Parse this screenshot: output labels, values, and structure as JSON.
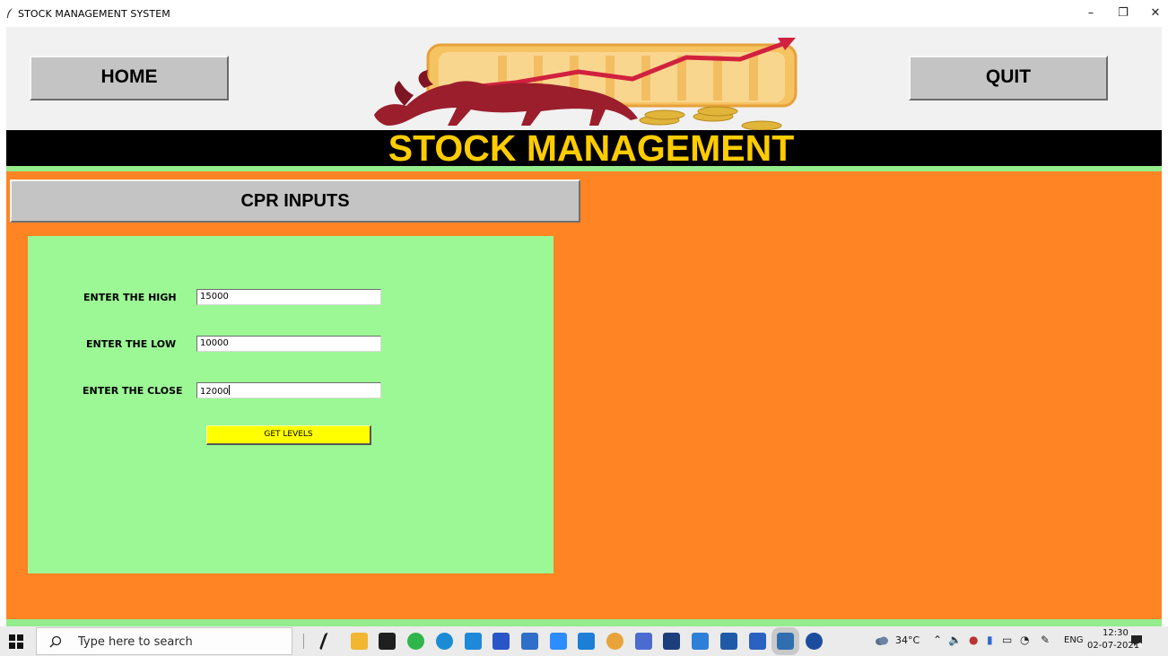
{
  "window": {
    "title": "STOCK MANAGEMENT SYSTEM",
    "min_glyph": "–",
    "max_glyph": "❐",
    "close_glyph": "✕"
  },
  "header": {
    "home_label": "HOME",
    "quit_label": "QUIT",
    "banner_title": "STOCK MANAGEMENT",
    "logo_icon": "bull-stock-chart-logo"
  },
  "section": {
    "title": "CPR INPUTS"
  },
  "form": {
    "high_label": "ENTER THE HIGH",
    "high_value": "15000",
    "low_label": "ENTER THE LOW",
    "low_value": "10000",
    "close_label": "ENTER THE CLOSE",
    "close_value": "12000",
    "submit_label": "GET LEVELS"
  },
  "taskbar": {
    "search_placeholder": "Type here to search",
    "temperature": "34°C",
    "language": "ENG",
    "time": "12:30",
    "date": "02-07-2021",
    "notification_count": "1",
    "apps": [
      {
        "name": "app-bolt-icon",
        "color": "#1a1a1a"
      },
      {
        "name": "file-explorer-icon",
        "color": "#f2b630"
      },
      {
        "name": "pycharm-icon",
        "color": "#1f1f1f"
      },
      {
        "name": "cortana-ring-icon",
        "color": "#30b54a"
      },
      {
        "name": "edge-icon",
        "color": "#1b8bd6"
      },
      {
        "name": "mail-icon",
        "color": "#1e88d9"
      },
      {
        "name": "dropbox-icon",
        "color": "#2a55c8"
      },
      {
        "name": "messenger-icon",
        "color": "#2f6ec9"
      },
      {
        "name": "zoom-icon",
        "color": "#2d8cff"
      },
      {
        "name": "vscode-icon",
        "color": "#1c7ed6"
      },
      {
        "name": "chrome-icon",
        "color": "#e8a33b"
      },
      {
        "name": "drive-icon",
        "color": "#4b6bd0"
      },
      {
        "name": "terminal-icon",
        "color": "#1c3f7c"
      },
      {
        "name": "pen-icon",
        "color": "#2e7fd8"
      },
      {
        "name": "calculator-icon",
        "color": "#1f5aa8"
      },
      {
        "name": "word-icon",
        "color": "#2b62c0"
      },
      {
        "name": "python-icon",
        "color": "#2f6fb0"
      },
      {
        "name": "help-icon",
        "color": "#1c4c9e"
      }
    ]
  }
}
